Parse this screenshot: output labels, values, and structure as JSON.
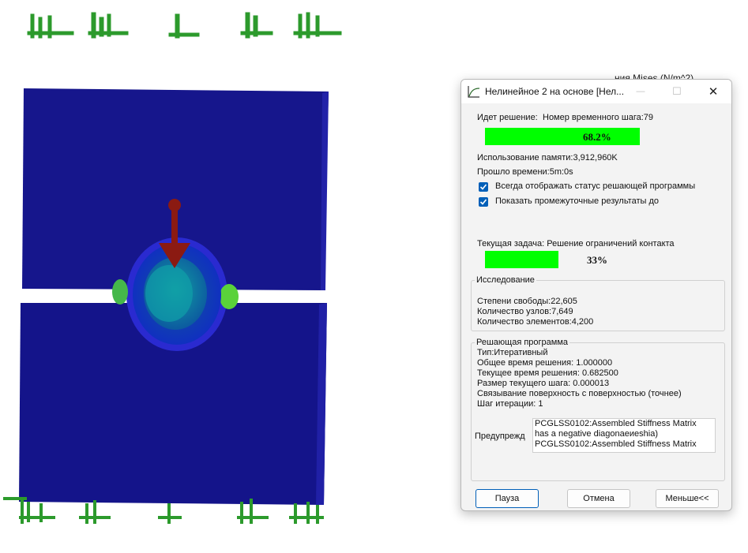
{
  "background_label": "ния Mises (N/m^2)",
  "colors": {
    "accent": "#005fb8",
    "progress": "#00ff00",
    "plate": "#16168c",
    "arrow": "#8b1a12",
    "fixture": "#2c9a2c"
  },
  "dialog": {
    "title": "Нелинейное 2 на основе [Нел...",
    "controls": {
      "minimize": "—",
      "maximize": "☐",
      "close": "✕"
    },
    "status_label": "Идет решение:",
    "step_label": "Номер временного шага:79",
    "main_progress": {
      "value": 0.682,
      "label": "68.2%"
    },
    "memory": "Использование памяти:3,912,960K",
    "elapsed": "Прошло времени:5m:0s",
    "checkbox_status": {
      "label": "Всегда отображать статус решающей программы",
      "checked": true
    },
    "checkbox_results": {
      "label": "Показать промежуточные результаты до",
      "checked": true
    },
    "current_task": "Текущая задача: Решение ограничений контакта",
    "task_progress": {
      "value": 0.33,
      "label": "33%"
    },
    "study": {
      "title": "Исследование",
      "dof": "Степени свободы:22,605",
      "nodes": "Количество узлов:7,649",
      "elements": "Количество элементов:4,200"
    },
    "solver": {
      "title": "Решающая программа",
      "type": "Тип:Итеративный",
      "total_time": "Общее время решения:  1.000000",
      "current_time": "Текущее время решения:  0.682500",
      "step_size": "Размер текущего шага: 0.000013",
      "contact": "Связывание поверхность с поверхностью (точнее)",
      "iteration": "Шаг итерации: 1",
      "warnings_label": "Предупрежд",
      "warnings": [
        "PCGLSS0102:Assembled Stiffness Matrix",
        "has a negative diagonaеиеshia)",
        "PCGLSS0102:Assembled Stiffness Matrix"
      ]
    },
    "buttons": {
      "pause": "Пауза",
      "cancel": "Отмена",
      "less": "Меньше<<"
    }
  }
}
